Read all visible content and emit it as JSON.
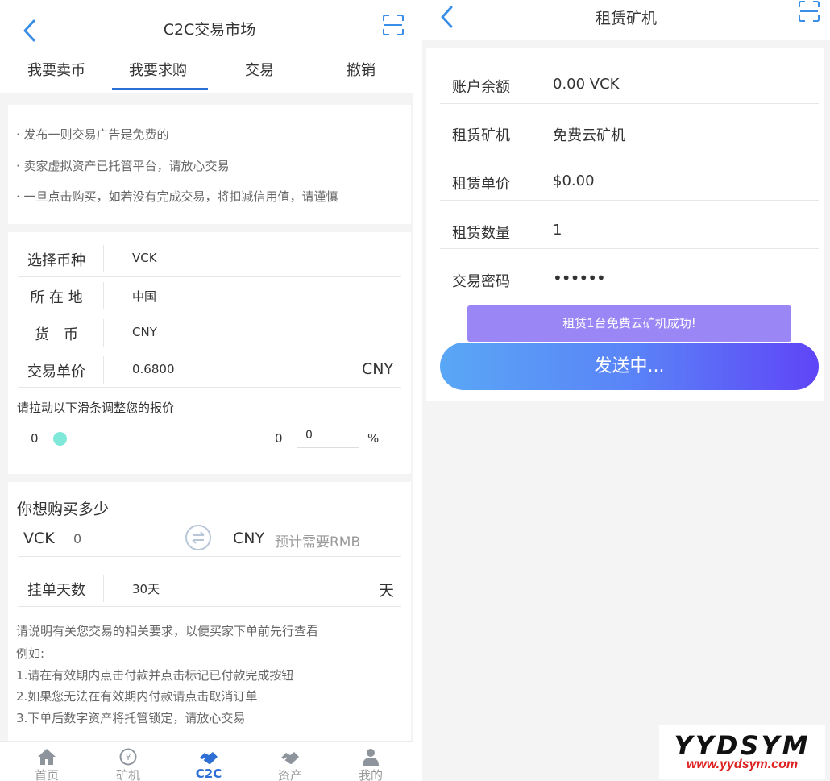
{
  "left": {
    "title": "C2C交易市场",
    "tabs": [
      "我要卖币",
      "我要求购",
      "交易",
      "撤销"
    ],
    "notices": [
      "· 发布一则交易广告是免费的",
      "· 卖家虚拟资产已托管平台，请放心交易",
      "· 一旦点击购买，如若没有完成交易，将扣减信用值，请谨慎"
    ],
    "form": {
      "coin_label": "选择币种",
      "coin_value": "VCK",
      "location_label": "所 在 地",
      "location_value": "中国",
      "currency_label": "货　币",
      "currency_value": "CNY",
      "price_label": "交易单价",
      "price_value": "0.6800",
      "price_unit": "CNY"
    },
    "slider": {
      "hint": "请拉动以下滑条调整您的报价",
      "min_label": "0",
      "value_label": "0",
      "input_value": "0",
      "unit": "%",
      "level": 0
    },
    "buy": {
      "heading": "你想购买多少",
      "coin": "VCK",
      "amount": "0",
      "fiat": "CNY",
      "fiat_placeholder": "预计需要RMB"
    },
    "days": {
      "label": "挂单天数",
      "value": "30天",
      "unit": "天"
    },
    "description": [
      "请说明有关您交易的相关要求，以便买家下单前先行查看",
      "例如:",
      "1.请在有效期内点击付款并点击标记已付款完成按钮",
      "2.如果您无法在有效期内付款请点击取消订单",
      "3.下单后数字资产将托管锁定，请放心交易"
    ],
    "tabbar": [
      {
        "label": "首页",
        "icon": "home-icon"
      },
      {
        "label": "矿机",
        "icon": "miner-coin-icon"
      },
      {
        "label": "C2C",
        "icon": "handshake-icon",
        "active": true
      },
      {
        "label": "资产",
        "icon": "assets-icon"
      },
      {
        "label": "我的",
        "icon": "user-icon"
      }
    ]
  },
  "right": {
    "title": "租赁矿机",
    "rows": [
      {
        "label": "账户余额",
        "value": "0.00 VCK"
      },
      {
        "label": "租赁矿机",
        "value": "免费云矿机"
      },
      {
        "label": "租赁单价",
        "value": "$0.00"
      },
      {
        "label": "租赁数量",
        "value": "1"
      },
      {
        "label": "交易密码",
        "value": "••••••"
      }
    ],
    "toast": "租赁1台免费云矿机成功!",
    "send_button": "发送中..."
  },
  "watermark": {
    "main": "YYDSYM",
    "sub": "www.yydsym.com"
  },
  "colors": {
    "accent": "#2e6fd6",
    "icon_blue": "#3a8ee6",
    "slider": "#7fe8d8",
    "toast": "#9a87f5",
    "button_start": "#5aa7f6",
    "button_end": "#5f45f7"
  }
}
